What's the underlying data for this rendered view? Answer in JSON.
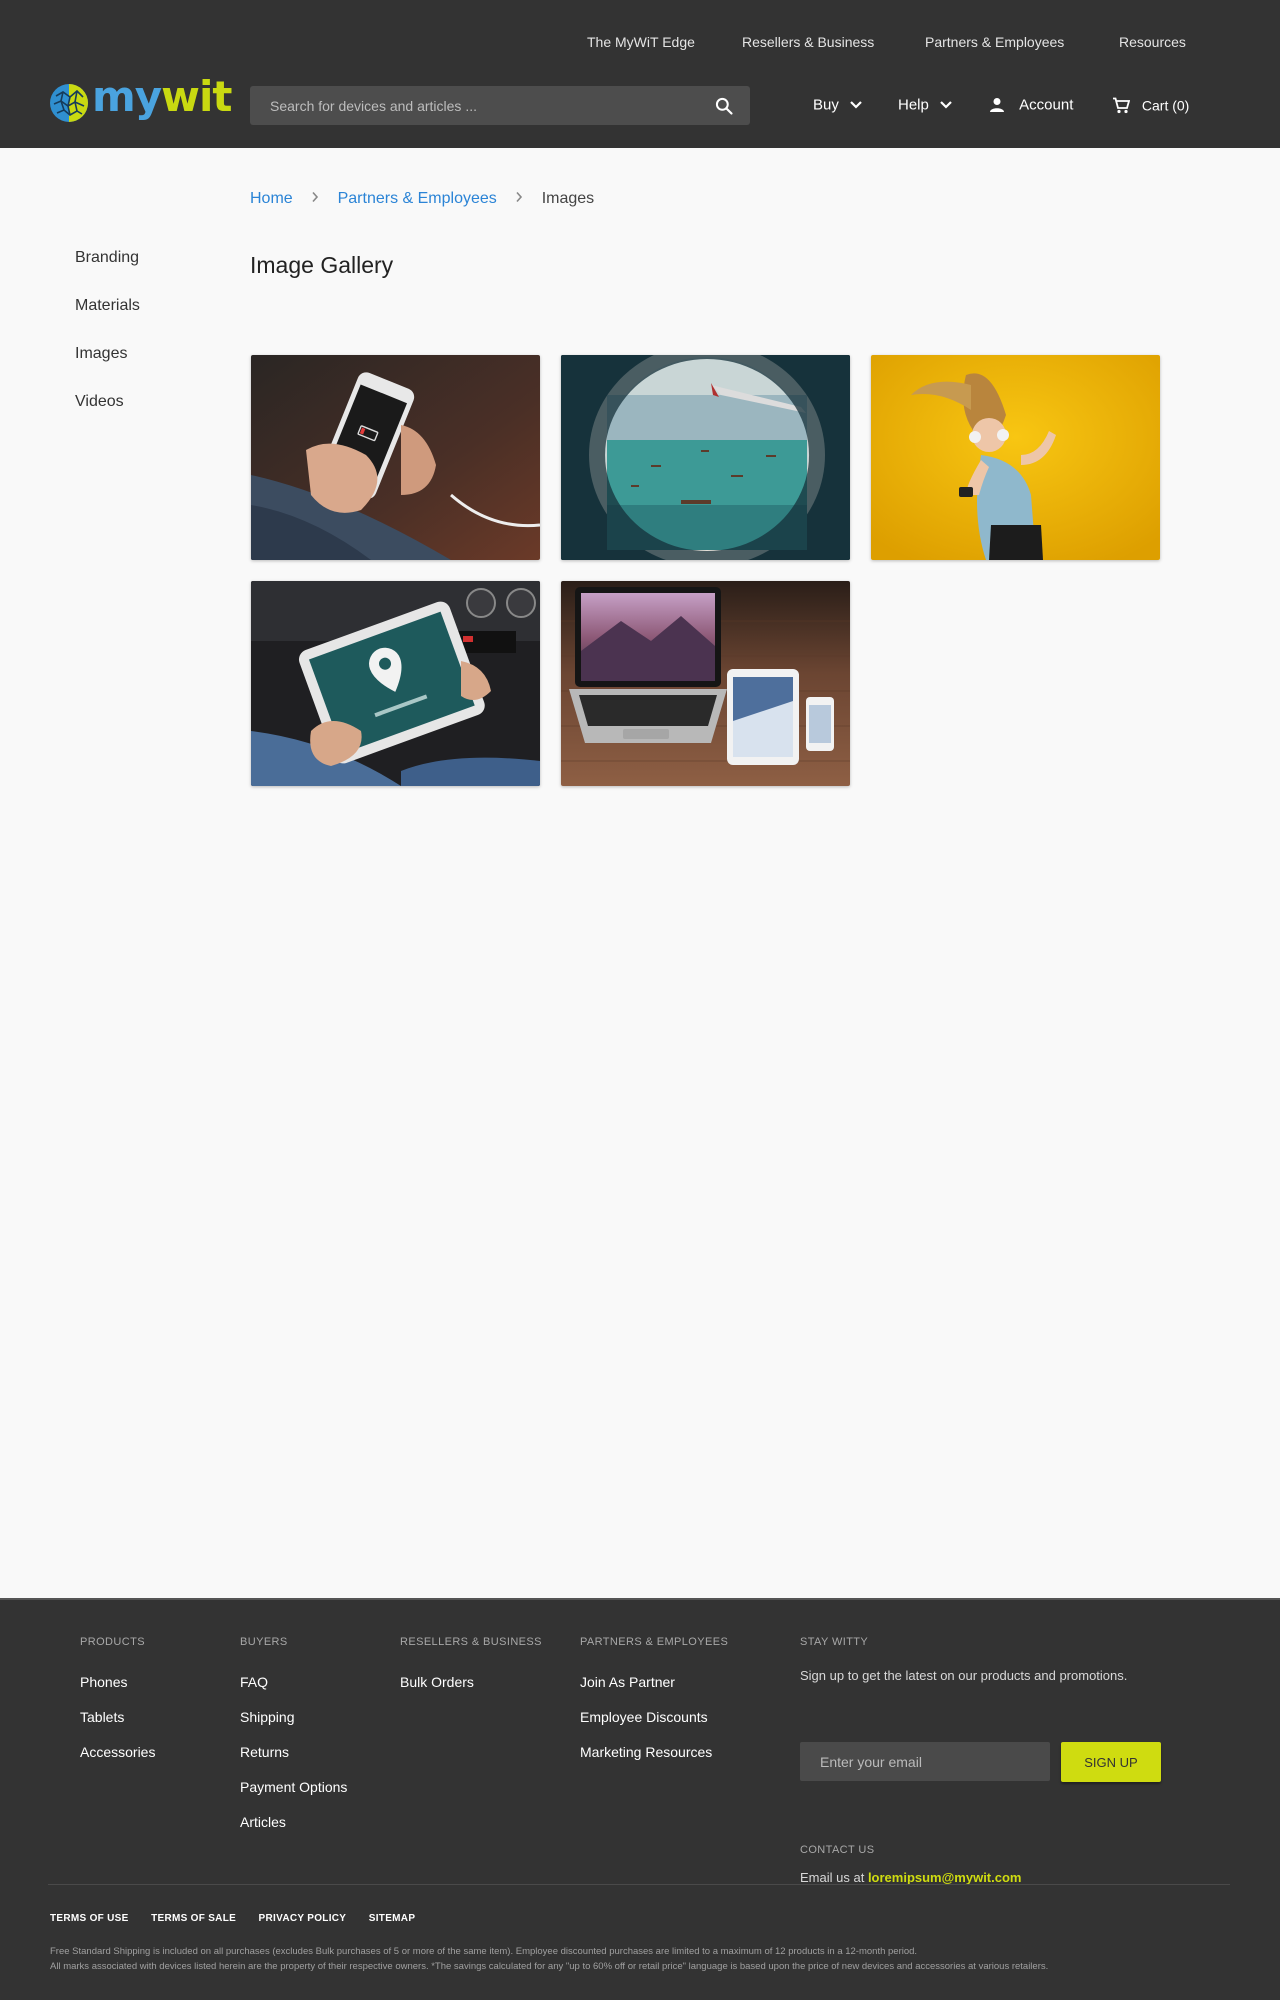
{
  "header": {
    "top_nav": [
      "The MyWiT Edge",
      "Resellers & Business",
      "Partners & Employees",
      "Resources"
    ],
    "logo": {
      "part1": "my",
      "part2": "wit"
    },
    "search": {
      "placeholder": "Search for devices and articles ..."
    },
    "buy_label": "Buy",
    "help_label": "Help",
    "account_label": "Account",
    "cart_label": "Cart",
    "cart_count": "(0)"
  },
  "breadcrumb": {
    "home": "Home",
    "section": "Partners & Employees",
    "current": "Images"
  },
  "sidebar": {
    "items": [
      "Branding",
      "Materials",
      "Images",
      "Videos"
    ]
  },
  "main": {
    "title": "Image Gallery"
  },
  "footer": {
    "columns": [
      {
        "heading": "PRODUCTS",
        "links": [
          "Phones",
          "Tablets",
          "Accessories"
        ]
      },
      {
        "heading": "BUYERS",
        "links": [
          "FAQ",
          "Shipping",
          "Returns",
          "Payment Options",
          "Articles"
        ]
      },
      {
        "heading": "RESELLERS & BUSINESS",
        "links": [
          "Bulk Orders"
        ]
      },
      {
        "heading": "PARTNERS & EMPLOYEES",
        "links": [
          "Join As Partner",
          "Employee Discounts",
          "Marketing Resources"
        ]
      }
    ],
    "stay_witty": {
      "heading": "STAY WITTY",
      "text": "Sign up to get the latest on our products and promotions.",
      "email_placeholder": "Enter your email",
      "button": "SIGN UP"
    },
    "contact": {
      "heading": "CONTACT US",
      "prefix": "Email us at",
      "email": "loremipsum@mywit.com"
    },
    "legal_links": [
      "TERMS OF USE",
      "TERMS OF SALE",
      "PRIVACY POLICY",
      "SITEMAP"
    ],
    "fine_print": [
      "Free Standard Shipping is included on all purchases (excludes Bulk purchases of 5 or more of the same item). Employee discounted purchases are limited to a maximum of 12 products in a 12-month period.",
      "All marks associated with devices listed herein are the property of their respective owners. *The savings calculated for any \"up to 60% off or retail price\" language is based upon the price of new devices and accessories at various retailers."
    ]
  },
  "colors": {
    "header_bg": "#333333",
    "link_blue": "#2b84d6",
    "accent_lime": "#cfdc10"
  }
}
